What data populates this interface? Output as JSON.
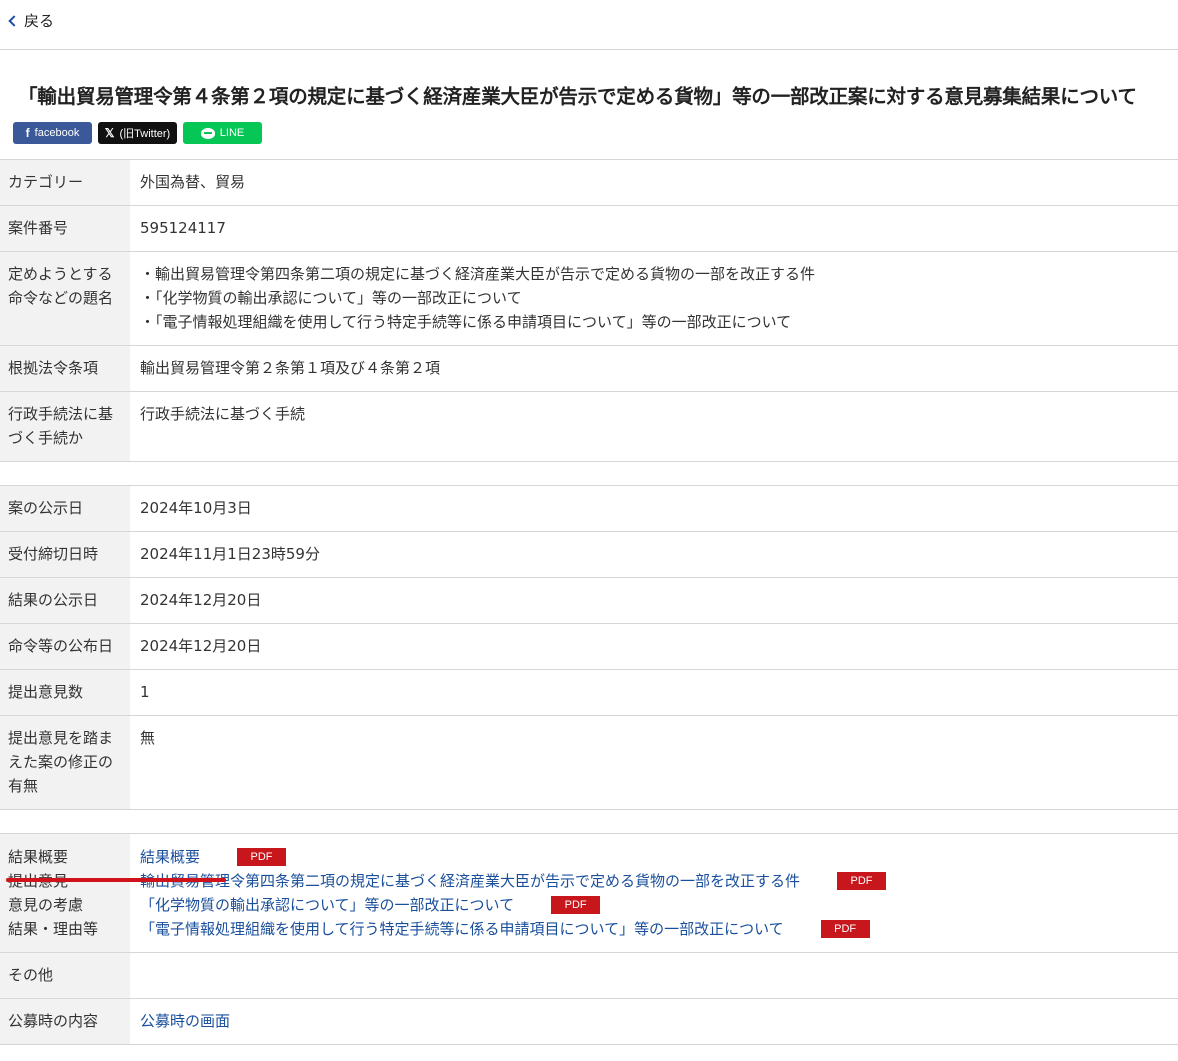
{
  "nav": {
    "back_label": "戻る"
  },
  "title": "「輸出貿易管理令第４条第２項の規定に基づく経済産業大臣が告示で定める貨物」等の一部改正案に対する意見募集結果について",
  "share": {
    "facebook_label": "facebook",
    "x_label": "(旧Twitter)",
    "line_label": "LINE"
  },
  "colors": {
    "link": "#1a4f9c",
    "pdf_badge": "#c8161d",
    "facebook": "#3b5998",
    "x": "#111111",
    "line": "#06c755",
    "label_bg": "#f2f2f2",
    "highlight_underline": "#d0121b"
  },
  "section1": {
    "category": {
      "label": "カテゴリー",
      "value": "外国為替、貿易"
    },
    "case_no": {
      "label": "案件番号",
      "value": "595124117"
    },
    "title_names": {
      "label": "定めようとする命令などの題名",
      "lines": [
        "・輸出貿易管理令第四条第二項の規定に基づく経済産業大臣が告示で定める貨物の一部を改正する件",
        "・「化学物質の輸出承認について」等の一部改正について",
        "・「電子情報処理組織を使用して行う特定手続等に係る申請項目について」等の一部改正について"
      ]
    },
    "legal_basis": {
      "label": "根拠法令条項",
      "value": "輸出貿易管理令第２条第１項及び４条第２項"
    },
    "procedure": {
      "label": "行政手続法に基づく手続か",
      "value": "行政手続法に基づく手続"
    }
  },
  "section2": {
    "published": {
      "label": "案の公示日",
      "value": "2024年10月3日"
    },
    "deadline": {
      "label": "受付締切日時",
      "value": "2024年11月1日23時59分"
    },
    "result_published": {
      "label": "結果の公示日",
      "value": "2024年12月20日"
    },
    "order_published": {
      "label": "命令等の公布日",
      "value": "2024年12月20日"
    },
    "opinion_count": {
      "label": "提出意見数",
      "value": "1"
    },
    "revised": {
      "label": "提出意見を踏まえた案の修正の有無",
      "value": "無"
    }
  },
  "section3": {
    "result_summary_label": "結果概要",
    "opinion_consideration_label": "提出意見\n意見の考慮\n結果・理由等",
    "pdf_label": "PDF",
    "links": [
      "結果概要",
      "輸出貿易管理令第四条第二項の規定に基づく経済産業大臣が告示で定める貨物の一部を改正する件",
      "「化学物質の輸出承認について」等の一部改正について",
      "「電子情報処理組織を使用して行う特定手続等に係る申請項目について」等の一部改正について"
    ],
    "other": {
      "label": "その他",
      "value": ""
    },
    "recruit": {
      "label": "公募時の内容",
      "link": "公募時の画面"
    }
  }
}
